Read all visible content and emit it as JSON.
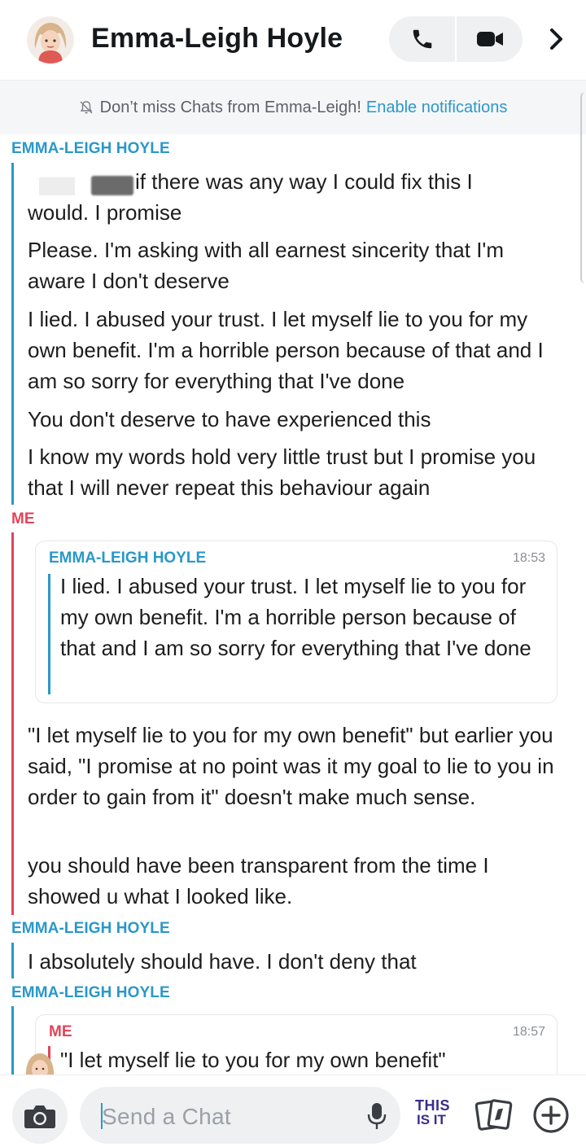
{
  "header": {
    "contact_name": "Emma-Leigh Hoyle",
    "icons": [
      "avatar-bitmoji",
      "phone-icon",
      "video-camera-icon",
      "chevron-right-icon"
    ]
  },
  "banner": {
    "text": "Don’t miss Chats from Emma-Leigh!",
    "link": "Enable notifications",
    "icon": "bell-off-icon"
  },
  "colors": {
    "them": "#2a98c9",
    "me": "#e0455b",
    "text": "#1d1d1f"
  },
  "chat": {
    "block1": {
      "sender": "EMMA-LEIGH HOYLE",
      "messages": [
        "if there was any way I could fix this I",
        "would. I promise",
        "Please. I'm asking with all earnest sincerity that I'm aware I don't deserve",
        "I lied. I abused your trust. I let myself lie to you for my own benefit. I'm a horrible person because of that and I am so sorry for everything that I've done",
        "You don't deserve to have experienced this",
        "I know my words hold very little trust but I promise you that I will never repeat this behaviour again"
      ]
    },
    "block2": {
      "sender": "ME",
      "quote": {
        "sender": "EMMA-LEIGH HOYLE",
        "time": "18:53",
        "text": "I lied. I abused your trust. I let myself lie to you for my own benefit. I'm a horrible person because of that and I am so sorry for everything that I've done"
      },
      "messages": [
        "\"I let myself lie to you for my own benefit\" but earlier you said, \"I promise at no point was it my goal to lie to you in order to gain from it\" doesn't make much sense.",
        "you should have been transparent from the time I showed u what I looked like."
      ]
    },
    "block3": {
      "sender": "EMMA-LEIGH HOYLE",
      "messages": [
        "I absolutely should have. I don't deny that"
      ]
    },
    "block4": {
      "sender": "EMMA-LEIGH HOYLE",
      "quote": {
        "sender": "ME",
        "time": "18:57",
        "text": "\"I let myself lie to you for my own benefit\""
      }
    }
  },
  "input": {
    "placeholder": "Send a Chat",
    "sticker_line1": "THIS",
    "sticker_line2": "IS IT",
    "icons": [
      "camera-icon",
      "microphone-icon",
      "sticker-icon",
      "cards-icon",
      "plus-icon"
    ]
  }
}
